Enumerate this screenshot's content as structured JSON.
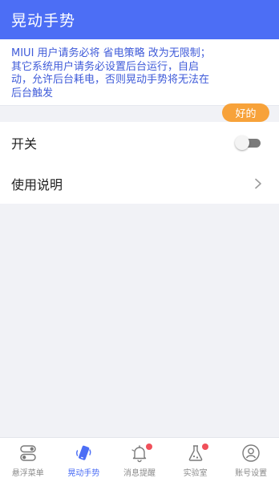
{
  "app": {
    "title": "晃动手势"
  },
  "notice": {
    "text": "MIUI 用户请务必将 省电策略 改为无限制；其它系统用户请务必设置后台运行，自启动，允许后台耗电，否则晃动手势将无法在后台触发",
    "ok_label": "好的"
  },
  "settings": {
    "switch_label": "开关",
    "switch_on": false,
    "help_label": "使用说明"
  },
  "bottom_nav": {
    "items": [
      {
        "label": "悬浮菜单",
        "icon": "toggle-menu-icon",
        "active": false,
        "badge": false
      },
      {
        "label": "晃动手势",
        "icon": "shake-phone-icon",
        "active": true,
        "badge": false
      },
      {
        "label": "消息提醒",
        "icon": "bell-icon",
        "active": false,
        "badge": true
      },
      {
        "label": "实验室",
        "icon": "flask-icon",
        "active": false,
        "badge": true
      },
      {
        "label": "账号设置",
        "icon": "user-icon",
        "active": false,
        "badge": false
      }
    ]
  },
  "colors": {
    "primary": "#4c6ef5",
    "notice_text": "#3f5bd9",
    "ok_button": "#f7a23a",
    "badge": "#f0505a"
  }
}
